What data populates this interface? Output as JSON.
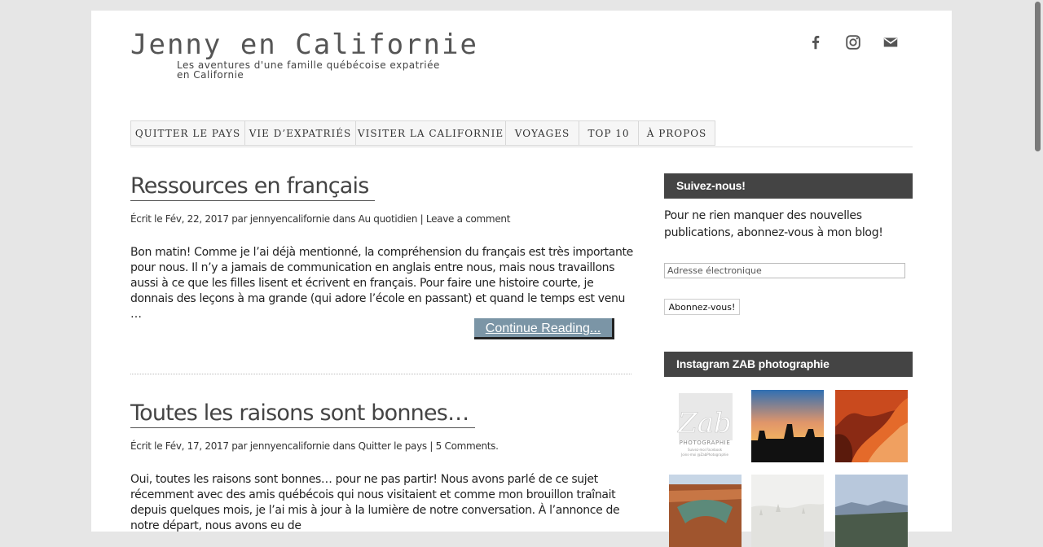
{
  "site": {
    "title": "Jenny en Californie",
    "tagline": "Les aventures d'une famille québécoise expatriée en Californie"
  },
  "social": [
    {
      "name": "facebook-icon"
    },
    {
      "name": "instagram-icon"
    },
    {
      "name": "email-icon"
    }
  ],
  "nav": [
    "QUITTER LE PAYS",
    "VIE D’EXPATRIÉS",
    "VISITER LA CALIFORNIE",
    "VOYAGES",
    "TOP 10",
    "À PROPOS"
  ],
  "posts": [
    {
      "title": "Ressources en français",
      "meta_prefix": "Écrit le Fév, 22, 2017 par ",
      "author": "jennyencalifornie",
      "meta_mid": " dans ",
      "category": "Au quotidien",
      "meta_sep": " | ",
      "comments": "Leave a comment",
      "excerpt": "Bon matin! Comme je l’ai déjà mentionné, la compréhension du français est très importante pour nous. Il n’y a jamais de communication en anglais entre nous, mais nous travaillons aussi à ce que les filles lisent et écrivent en français. Pour faire une histoire courte, je donnais des leçons à ma grande (qui adore l’école en passant) et quand le temps est venu …",
      "continue_label": "Continue Reading..."
    },
    {
      "title": "Toutes les raisons sont bonnes…",
      "meta_prefix": "Écrit le Fév, 17, 2017 par ",
      "author": "jennyencalifornie",
      "meta_mid": " dans ",
      "category": "Quitter le pays",
      "meta_sep": " | ",
      "comments": "5 Comments.",
      "excerpt": "Oui, toutes les raisons sont bonnes… pour ne pas partir! Nous avons parlé de ce sujet récemment avec des amis québécois qui nous visitaient et comme mon brouillon traînait depuis quelques mois, je l’ai mis à jour à la lumière de notre conversation. À l’annonce de notre départ, nous avons eu de"
    }
  ],
  "sidebar": {
    "follow": {
      "title": "Suivez-nous!",
      "text": "Pour ne rien manquer des nouvelles publications, abonnez-vous à mon blog!",
      "email_placeholder": "Adresse électronique",
      "button_label": "Abonnez-vous!"
    },
    "instagram": {
      "title": "Instagram ZAB photographie",
      "logo_text": "Zab",
      "logo_sub": "PHOTOGRAPHIE",
      "logo_line1": "Suivez-moi Facebook",
      "logo_line2": "Joins-moi @ZabPhotographie"
    }
  },
  "colors": {
    "background": "#e6e6e6",
    "widget_header": "#444444",
    "continue_button": "#7b95a6"
  }
}
